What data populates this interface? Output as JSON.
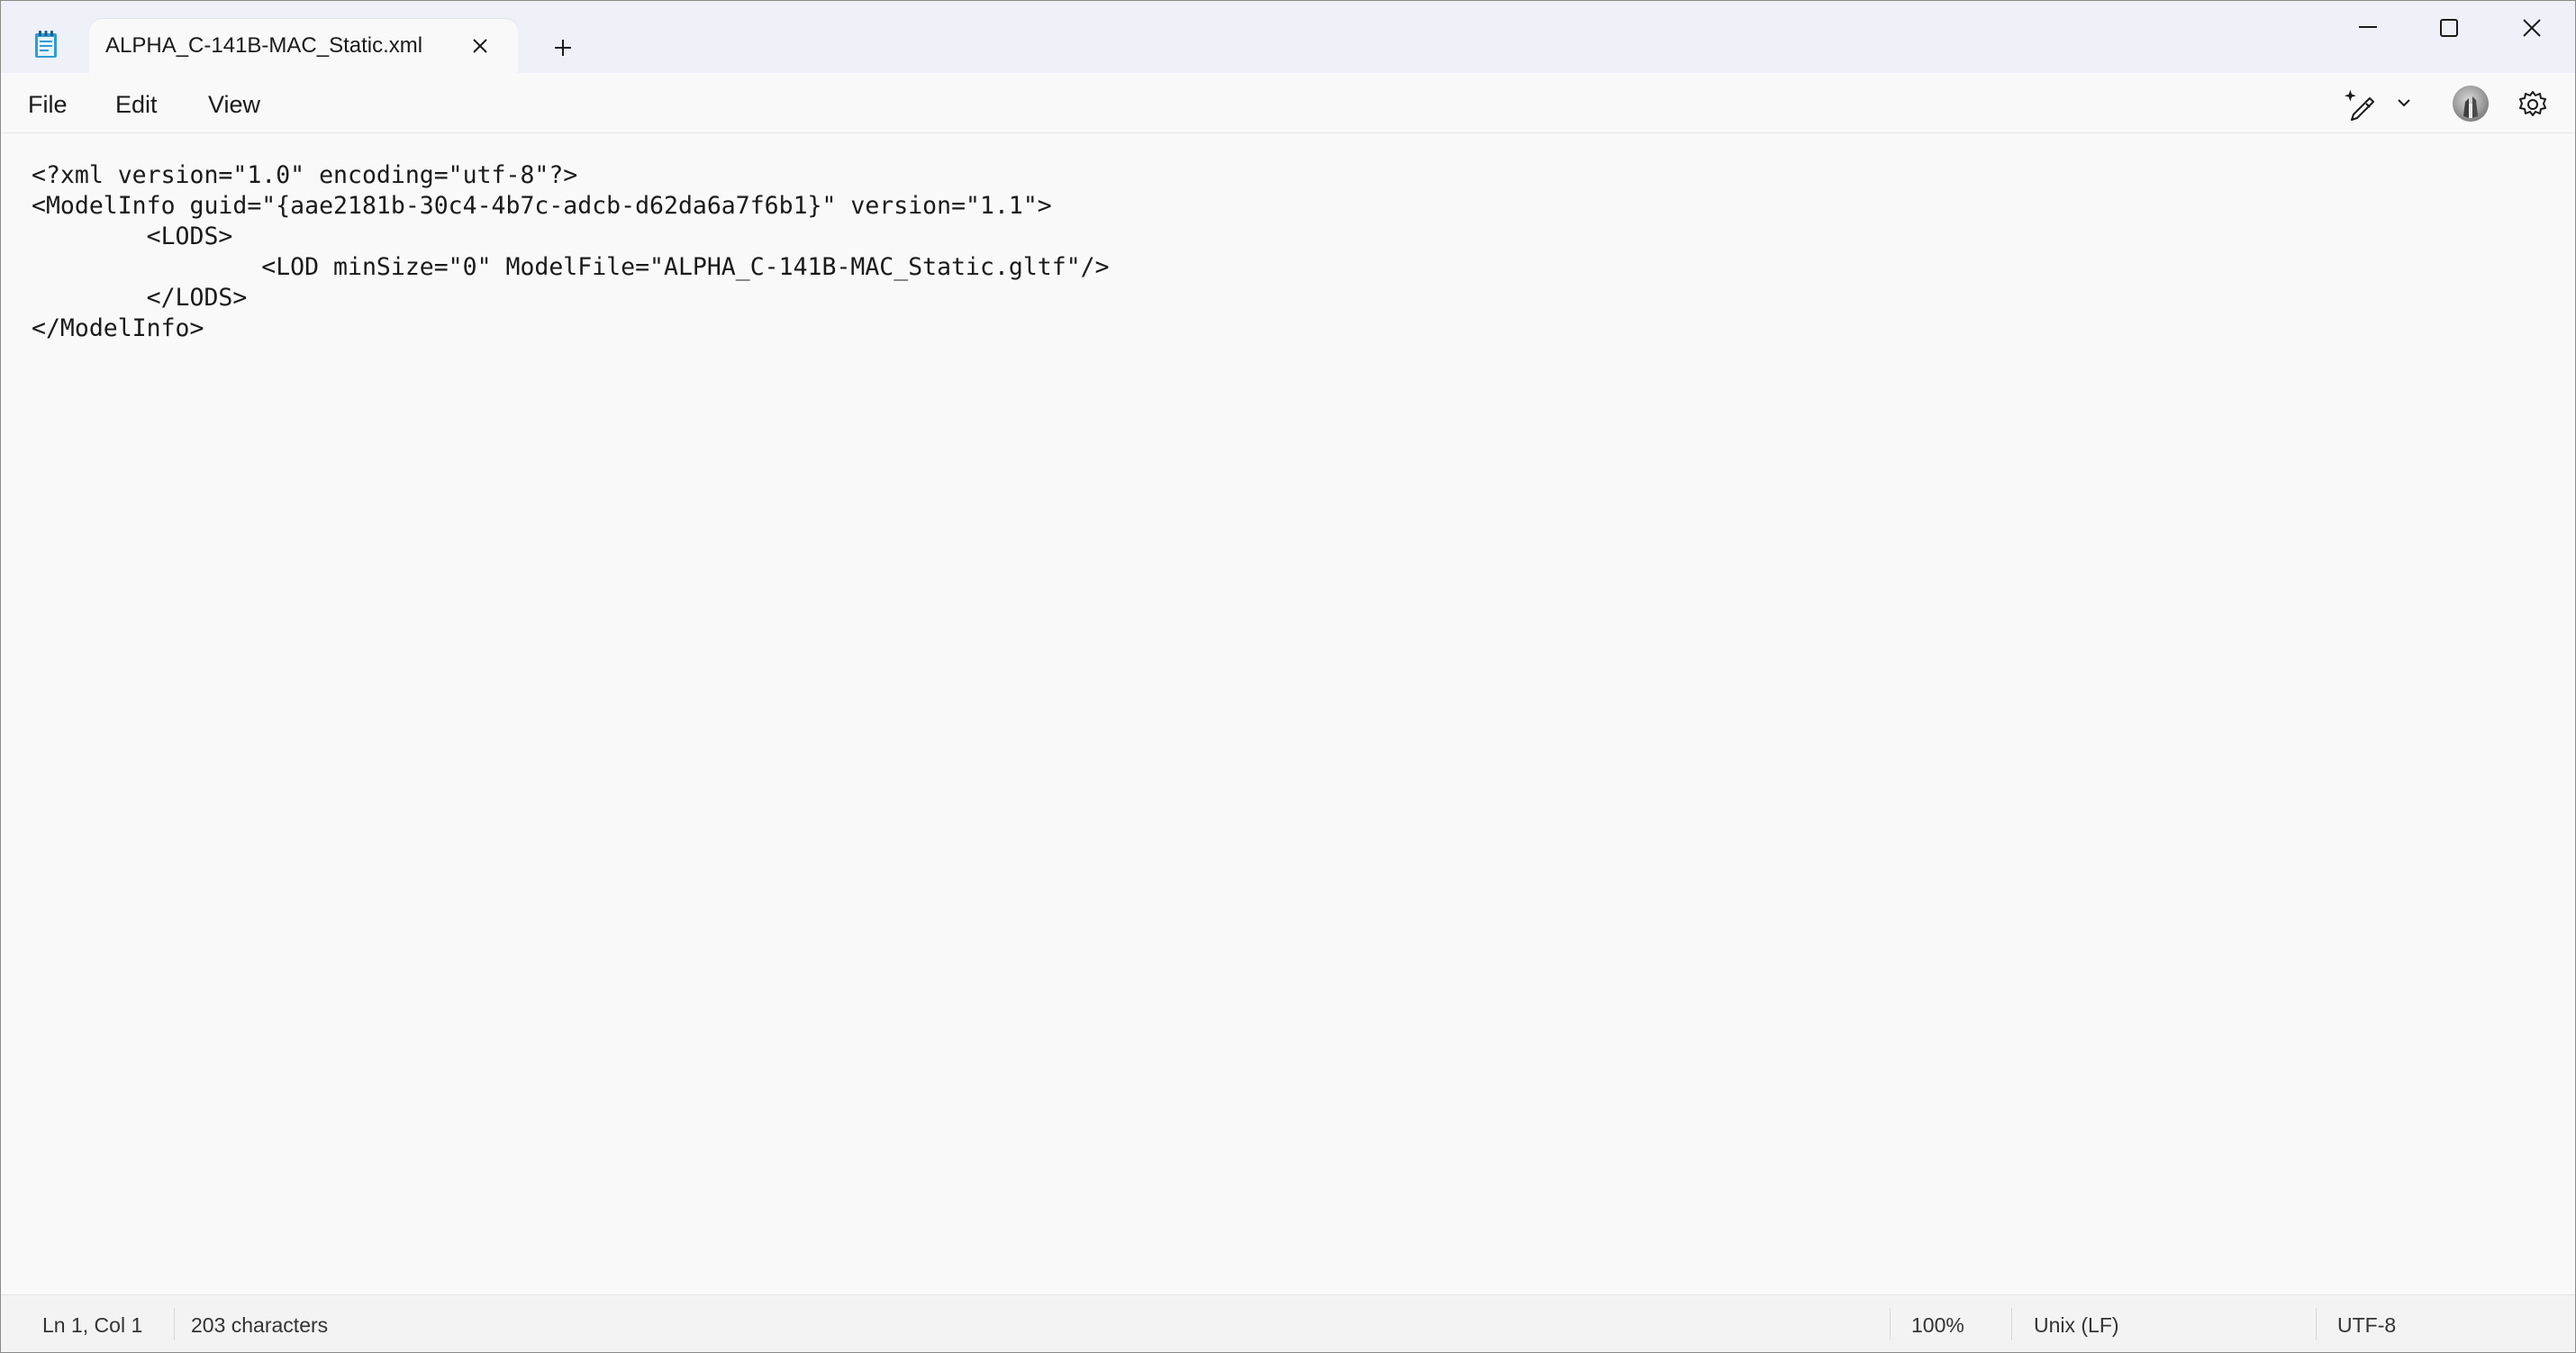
{
  "window": {
    "tab_title": "ALPHA_C-141B-MAC_Static.xml",
    "icons": {
      "app": "notepad-icon",
      "tab_close": "close-icon",
      "new_tab": "plus-icon",
      "minimize": "minimize-icon",
      "maximize": "maximize-icon",
      "close": "close-icon"
    }
  },
  "menu": {
    "items": [
      "File",
      "Edit",
      "View"
    ],
    "right_icons": [
      "copilot-pen-icon",
      "chevron-down-icon",
      "avatar",
      "gear-icon"
    ]
  },
  "editor": {
    "lines": [
      "<?xml version=\"1.0\" encoding=\"utf-8\"?>",
      "<ModelInfo guid=\"{aae2181b-30c4-4b7c-adcb-d62da6a7f6b1}\" version=\"1.1\">",
      "        <LODS>",
      "                <LOD minSize=\"0\" ModelFile=\"ALPHA_C-141B-MAC_Static.gltf\"/>",
      "        </LODS>",
      "</ModelInfo>"
    ]
  },
  "status": {
    "position": "Ln 1, Col 1",
    "characters": "203 characters",
    "zoom": "100%",
    "line_ending": "Unix (LF)",
    "encoding": "UTF-8"
  },
  "colors": {
    "titlebar": "#eef1f7",
    "background": "#f9f9f9",
    "statusbar": "#f3f3f3",
    "text": "#1a1a1a"
  }
}
